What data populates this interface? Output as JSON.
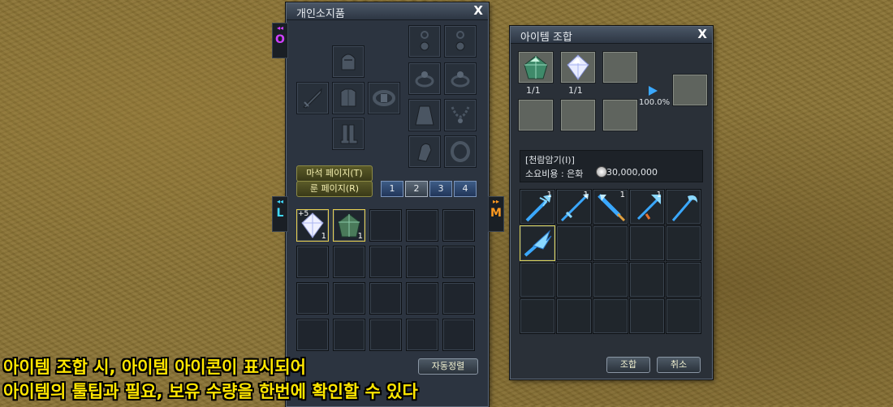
{
  "inventory": {
    "title": "개인소지품",
    "close": "X",
    "left_tab_o": "O",
    "left_tab_l": "L",
    "right_tab_m": "M",
    "side_arrows": "◂◂",
    "side_arrows_r": "▸▸",
    "magic_stone_page": "마석 페이지(T)",
    "rune_page": "룬 페이지(R)",
    "tabs": [
      "1",
      "2",
      "3",
      "4"
    ],
    "active_tab": "2",
    "item1_count": "1",
    "item1_badge": "+5",
    "item2_count": "1",
    "auto_sort": "자동정렬"
  },
  "combine": {
    "title": "아이템 조합",
    "close": "X",
    "slot1_count": "1/1",
    "slot2_count": "1/1",
    "rate": "100.0%",
    "recipe_name": "[천람암기(Ⅰ)]",
    "cost_label": "소요비용 : 은화",
    "cost_value": "30,000,000",
    "result_counts": [
      "1",
      "1",
      "1",
      "1",
      ""
    ],
    "combine_button": "조합",
    "cancel_button": "취소"
  },
  "caption": {
    "line1": "아이템 조합 시, 아이템 아이콘이 표시되어",
    "line2": "아이템의 툴팁과 필요, 보유 수량을 한번에 확인할 수 있다"
  },
  "colors": {
    "caption": "#ffe600",
    "window_bg": "#2c3440",
    "weapon_blue": "#3aa8ff"
  }
}
